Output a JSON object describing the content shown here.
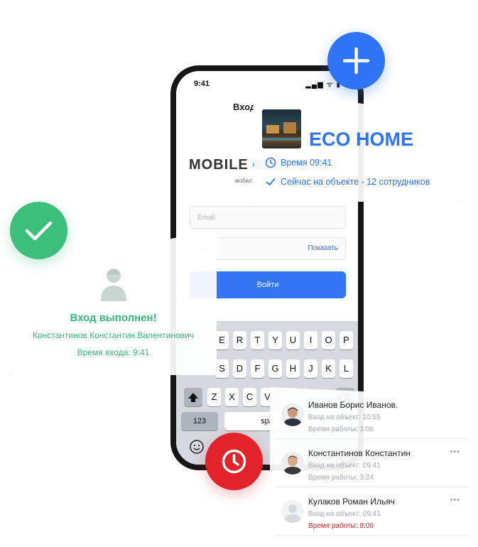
{
  "phone": {
    "status_time": "9:41",
    "status_icons": "▂▄▆ ᯤ ▮",
    "nav_title": "Вход",
    "brand": "MOBILE",
    "brand_sub": "мобил",
    "email_placeholder": "Email",
    "password_placeholder": "ль",
    "show_label": "Показать",
    "login_label": "Войти",
    "keyboard": {
      "row1": [
        "E",
        "R",
        "T",
        "Y",
        "U",
        "I",
        "O",
        "P"
      ],
      "row2": [
        "S",
        "D",
        "F",
        "G",
        "H",
        "J",
        "K",
        "L"
      ],
      "row3": [
        "Z",
        "X",
        "C",
        "V"
      ],
      "numbers_key": "123",
      "space_key": "spa"
    }
  },
  "eco_card": {
    "title": "ECO HOME",
    "time": "Время 09:41",
    "on_site": "Сейчас на объекте - 12 сотрудников"
  },
  "login_card": {
    "title": "Вход выполнен!",
    "name": "Константинов  Константин Валентинович",
    "time": "Время входа: 9:41"
  },
  "employees": [
    {
      "name": "Иванов  Борис Иванов.",
      "enter": "Вход на объект: 10:55",
      "work": "Время работы: 3:06",
      "overtime": false,
      "more": ""
    },
    {
      "name": "Константинов  Константин",
      "enter": "Вход на объект: 09:41",
      "work": "Время работы: 3:24",
      "overtime": false,
      "more": "•••"
    },
    {
      "name": "Кулаков Роман Ильяч",
      "enter": "Вход на объект: 09:41",
      "work": "Время работы: 8:06",
      "overtime": true,
      "more": "•••"
    }
  ],
  "colors": {
    "accent_blue": "#2f74f6",
    "success_green": "#3dbf7c",
    "alert_red": "#e2242a"
  },
  "icons": {
    "plus": "plus-icon",
    "check": "check-icon",
    "clock": "clock-icon",
    "emoji": "emoji-icon",
    "shift": "shift-icon",
    "backspace": "backspace-icon"
  }
}
